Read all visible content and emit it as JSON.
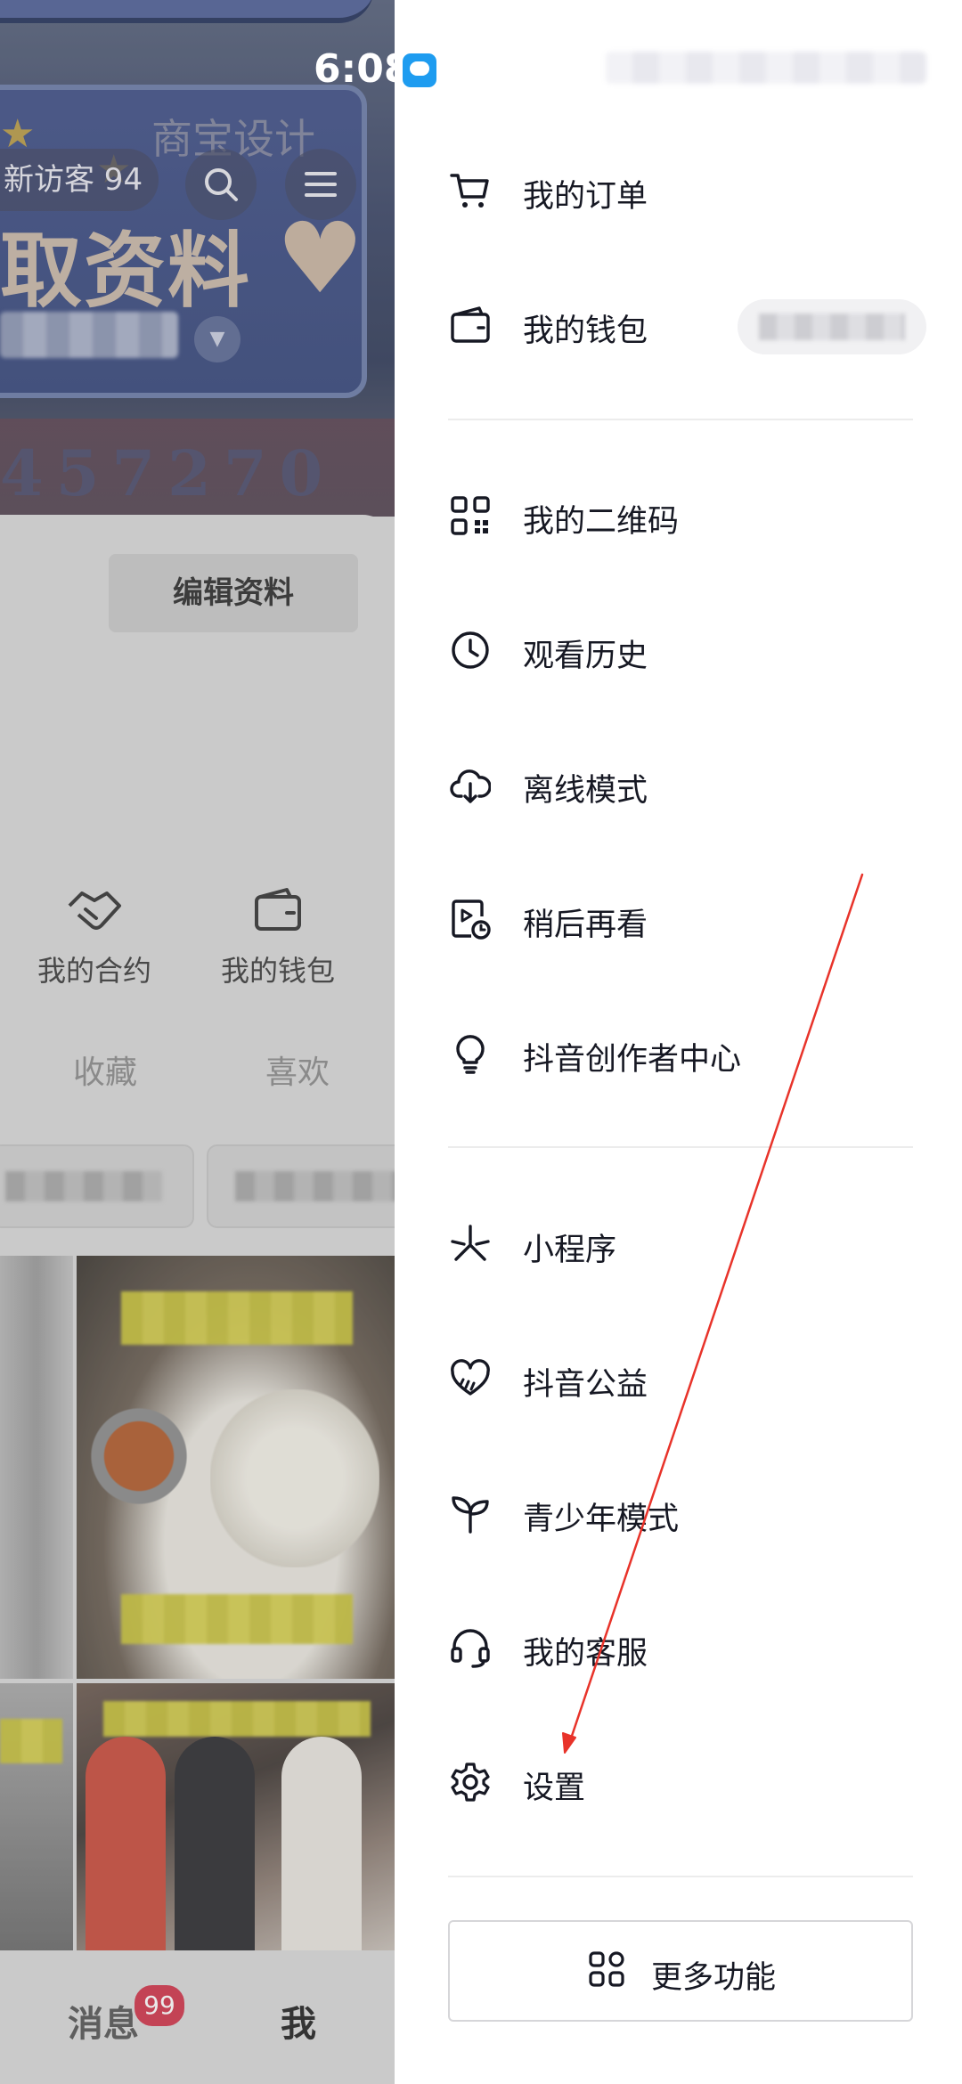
{
  "status_bar": {
    "time": "6:08"
  },
  "background_profile": {
    "cover": {
      "brand_text": "商宝设计",
      "headline": "取资料",
      "number_strip": "457270"
    },
    "visitor_badge": "新访客 94",
    "edit_profile_button": "编辑资料",
    "quick_actions": [
      {
        "label": "我的合约",
        "icon": "handshake-icon"
      },
      {
        "label": "我的钱包",
        "icon": "wallet-icon"
      }
    ],
    "tabs": [
      "收藏",
      "喜欢"
    ],
    "bottom_nav": {
      "messages_label": "消息",
      "messages_badge": "99",
      "me_label": "我"
    }
  },
  "drawer": {
    "groups": [
      [
        {
          "label": "我的订单",
          "icon": "cart-icon"
        },
        {
          "label": "我的钱包",
          "icon": "wallet-icon"
        }
      ],
      [
        {
          "label": "我的二维码",
          "icon": "qrcode-icon"
        },
        {
          "label": "观看历史",
          "icon": "clock-icon"
        },
        {
          "label": "离线模式",
          "icon": "cloud-download-icon"
        },
        {
          "label": "稍后再看",
          "icon": "watch-later-icon"
        },
        {
          "label": "抖音创作者中心",
          "icon": "lightbulb-icon"
        }
      ],
      [
        {
          "label": "小程序",
          "icon": "mini-program-icon"
        },
        {
          "label": "抖音公益",
          "icon": "charity-heart-icon"
        },
        {
          "label": "青少年模式",
          "icon": "sprout-icon"
        },
        {
          "label": "我的客服",
          "icon": "headset-icon"
        },
        {
          "label": "设置",
          "icon": "gear-icon"
        }
      ]
    ],
    "more_button": {
      "label": "更多功能",
      "icon": "grid-icon"
    }
  },
  "colors": {
    "annotation_arrow": "#e8332a",
    "text": "#161823",
    "badge": "#d0344a"
  }
}
